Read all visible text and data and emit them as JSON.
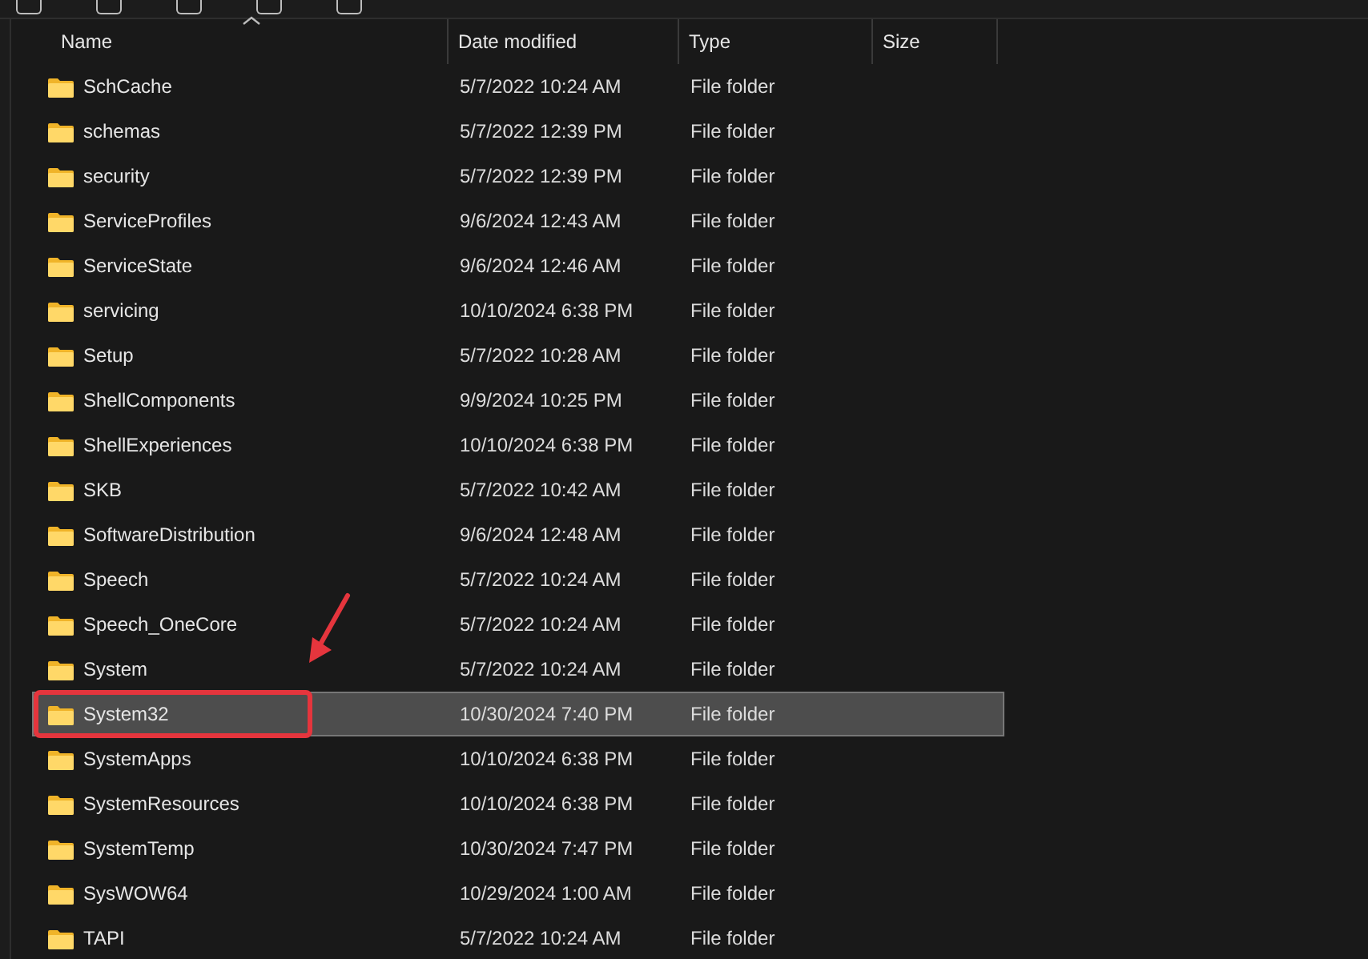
{
  "table": {
    "columns": [
      {
        "label": "Name",
        "sorted": true
      },
      {
        "label": "Date modified",
        "sorted": false
      },
      {
        "label": "Type",
        "sorted": false
      },
      {
        "label": "Size",
        "sorted": false
      }
    ],
    "rows": [
      {
        "name": "SchCache",
        "date": "5/7/2022 10:24 AM",
        "type": "File folder",
        "selected": false,
        "annotated": false
      },
      {
        "name": "schemas",
        "date": "5/7/2022 12:39 PM",
        "type": "File folder",
        "selected": false,
        "annotated": false
      },
      {
        "name": "security",
        "date": "5/7/2022 12:39 PM",
        "type": "File folder",
        "selected": false,
        "annotated": false
      },
      {
        "name": "ServiceProfiles",
        "date": "9/6/2024 12:43 AM",
        "type": "File folder",
        "selected": false,
        "annotated": false
      },
      {
        "name": "ServiceState",
        "date": "9/6/2024 12:46 AM",
        "type": "File folder",
        "selected": false,
        "annotated": false
      },
      {
        "name": "servicing",
        "date": "10/10/2024 6:38 PM",
        "type": "File folder",
        "selected": false,
        "annotated": false
      },
      {
        "name": "Setup",
        "date": "5/7/2022 10:28 AM",
        "type": "File folder",
        "selected": false,
        "annotated": false
      },
      {
        "name": "ShellComponents",
        "date": "9/9/2024 10:25 PM",
        "type": "File folder",
        "selected": false,
        "annotated": false
      },
      {
        "name": "ShellExperiences",
        "date": "10/10/2024 6:38 PM",
        "type": "File folder",
        "selected": false,
        "annotated": false
      },
      {
        "name": "SKB",
        "date": "5/7/2022 10:42 AM",
        "type": "File folder",
        "selected": false,
        "annotated": false
      },
      {
        "name": "SoftwareDistribution",
        "date": "9/6/2024 12:48 AM",
        "type": "File folder",
        "selected": false,
        "annotated": false
      },
      {
        "name": "Speech",
        "date": "5/7/2022 10:24 AM",
        "type": "File folder",
        "selected": false,
        "annotated": false
      },
      {
        "name": "Speech_OneCore",
        "date": "5/7/2022 10:24 AM",
        "type": "File folder",
        "selected": false,
        "annotated": false
      },
      {
        "name": "System",
        "date": "5/7/2022 10:24 AM",
        "type": "File folder",
        "selected": false,
        "annotated": false
      },
      {
        "name": "System32",
        "date": "10/30/2024 7:40 PM",
        "type": "File folder",
        "selected": true,
        "annotated": true
      },
      {
        "name": "SystemApps",
        "date": "10/10/2024 6:38 PM",
        "type": "File folder",
        "selected": false,
        "annotated": false
      },
      {
        "name": "SystemResources",
        "date": "10/10/2024 6:38 PM",
        "type": "File folder",
        "selected": false,
        "annotated": false
      },
      {
        "name": "SystemTemp",
        "date": "10/30/2024 7:47 PM",
        "type": "File folder",
        "selected": false,
        "annotated": false
      },
      {
        "name": "SysWOW64",
        "date": "10/29/2024 1:00 AM",
        "type": "File folder",
        "selected": false,
        "annotated": false
      },
      {
        "name": "TAPI",
        "date": "5/7/2022 10:24 AM",
        "type": "File folder",
        "selected": false,
        "annotated": false
      }
    ]
  }
}
